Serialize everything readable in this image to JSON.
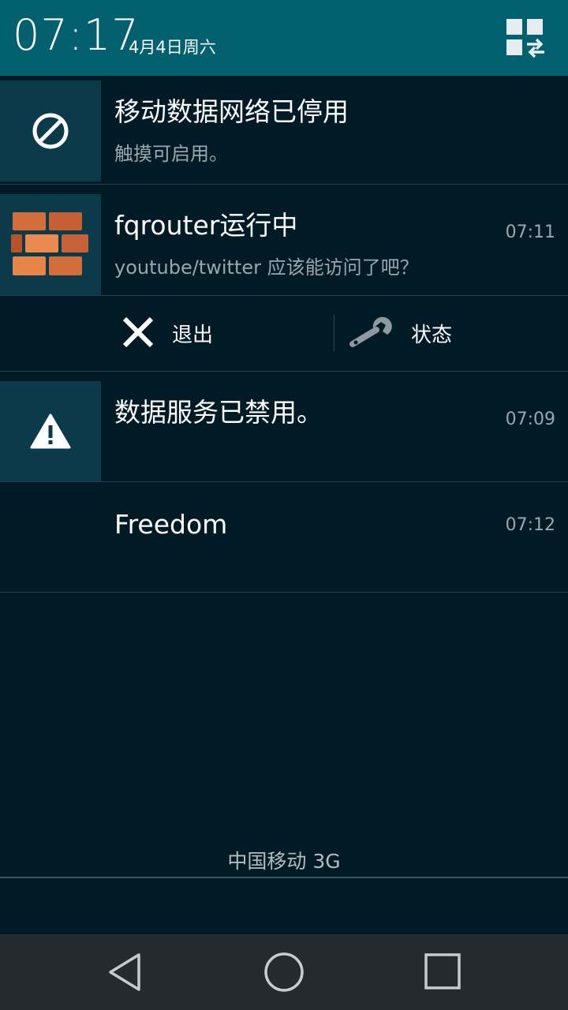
{
  "status": {
    "time": "07:17",
    "date": "4月4日周六"
  },
  "notifications": [
    {
      "icon": "block-icon",
      "title": "移动数据网络已停用",
      "subtitle": "触摸可启用。",
      "time": ""
    },
    {
      "icon": "brick-wall-icon",
      "title": "fqrouter运行中",
      "subtitle": "youtube/twitter 应该能访问了吧？",
      "time": "07:11",
      "actions": [
        {
          "icon": "close-icon",
          "label": "退出"
        },
        {
          "icon": "wrench-icon",
          "label": "状态"
        }
      ]
    },
    {
      "icon": "warning-icon",
      "title": "数据服务已禁用。",
      "subtitle": "",
      "time": "07:09"
    },
    {
      "icon": "",
      "title": "Freedom",
      "subtitle": "",
      "time": "07:12"
    }
  ],
  "carrier": "中国移动 3G",
  "navbar": {
    "back": "back-icon",
    "home": "home-icon",
    "recents": "recents-icon"
  },
  "colors": {
    "header": "#02606f",
    "background": "#001b26",
    "icon_box": "#0b3a4b",
    "navbar": "#252a2e"
  }
}
